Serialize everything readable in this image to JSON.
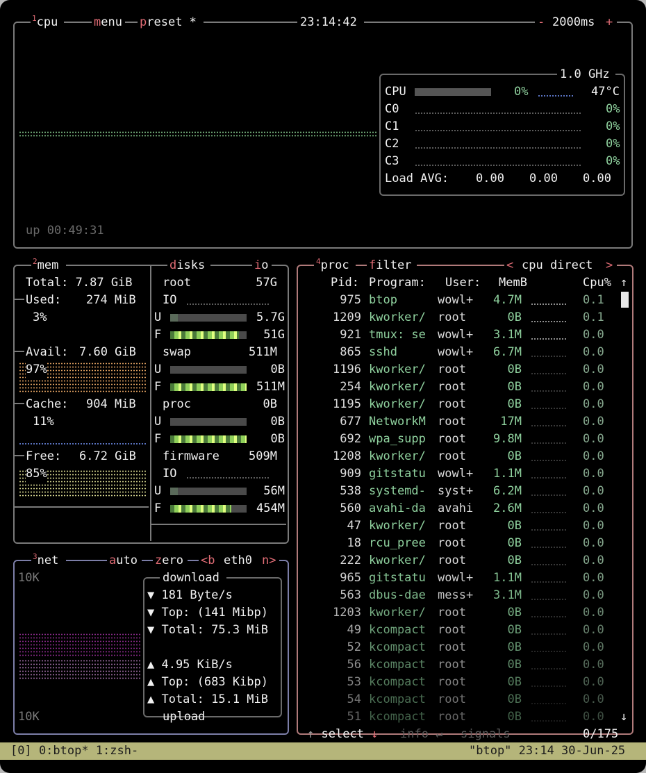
{
  "cpu": {
    "num": "1",
    "title": "cpu",
    "menu_m": "m",
    "menu": "enu",
    "preset_p": "p",
    "preset": "reset *",
    "clock": "23:14:42",
    "minus": "-",
    "interval": "2000ms",
    "plus": "+",
    "freq": "1.0 GHz",
    "total_label": "CPU",
    "total_pct": "0%",
    "temp": "47°C",
    "cores": [
      {
        "label": "C0",
        "pct": "0%"
      },
      {
        "label": "C1",
        "pct": "0%"
      },
      {
        "label": "C2",
        "pct": "0%"
      },
      {
        "label": "C3",
        "pct": "0%"
      }
    ],
    "load_label": "Load AVG:",
    "load": [
      "0.00",
      "0.00",
      "0.00"
    ],
    "uptime": "up 00:49:31"
  },
  "mem": {
    "num": "2",
    "title": "mem",
    "total": "Total: 7.87 GiB",
    "used_label": "Used:",
    "used_val": "274 MiB",
    "used_pct": "3%",
    "avail_label": "Avail:",
    "avail_val": "7.60 GiB",
    "avail_pct": "97%",
    "cache_label": "Cache:",
    "cache_val": "904 MiB",
    "cache_pct": "11%",
    "free_label": "Free:",
    "free_val": "6.72 GiB",
    "free_pct": "85%"
  },
  "disks": {
    "title_d": "d",
    "title": "isks",
    "io_i": "i",
    "io": "o",
    "items": [
      {
        "name": "root",
        "size": "57G",
        "rows": [
          {
            "k": "IO",
            "v": ""
          },
          {
            "k": "U",
            "v": "5.7G",
            "fill": 0.1
          },
          {
            "k": "F",
            "v": "51G",
            "fill": 0.9
          }
        ]
      },
      {
        "name": "swap",
        "size": "511M",
        "rows": [
          {
            "k": "U",
            "v": "0B",
            "fill": 0
          },
          {
            "k": "F",
            "v": "511M",
            "fill": 1
          }
        ]
      },
      {
        "name": "proc",
        "size": "0B",
        "rows": [
          {
            "k": "U",
            "v": "0B",
            "fill": 0
          },
          {
            "k": "F",
            "v": "0B",
            "fill": 1
          }
        ]
      },
      {
        "name": "firmware",
        "size": "509M",
        "rows": [
          {
            "k": "IO",
            "v": ""
          },
          {
            "k": "U",
            "v": "56M",
            "fill": 0.1
          },
          {
            "k": "F",
            "v": "454M",
            "fill": 0.8
          }
        ]
      }
    ]
  },
  "net": {
    "num": "3",
    "title": "net",
    "auto_a": "a",
    "auto": "uto",
    "zero_z": "z",
    "zero": "ero",
    "iface_b": "<b",
    "iface": "eth0",
    "iface_n": "n>",
    "scale_top": "10K",
    "scale_bottom": "10K",
    "download": "download",
    "upload": "upload",
    "down": [
      "▼ 181 Byte/s",
      "▼ Top: (141 Mibp)",
      "▼ Total: 75.3 MiB"
    ],
    "up": [
      "▲ 4.95 KiB/s",
      "▲ Top: (683 Kibp)",
      "▲ Total: 15.1 MiB"
    ]
  },
  "proc": {
    "num": "4",
    "title": "proc",
    "filter_f": "f",
    "filter": "ilter",
    "sort_l": "<",
    "sort": "cpu direct",
    "sort_r": ">",
    "headers": {
      "pid": "Pid:",
      "program": "Program:",
      "user": "User:",
      "mem": "MemB",
      "cpu": "Cpu%",
      "arrow": "↑"
    },
    "rows": [
      {
        "pid": "975",
        "prog": "btop",
        "user": "wowl+",
        "mem": "4.7M",
        "cpu": "0.1"
      },
      {
        "pid": "1209",
        "prog": "kworker/",
        "user": "root",
        "mem": "0B",
        "cpu": "0.1"
      },
      {
        "pid": "921",
        "prog": "tmux: se",
        "user": "wowl+",
        "mem": "3.1M",
        "cpu": "0.0"
      },
      {
        "pid": "865",
        "prog": "sshd",
        "user": "wowl+",
        "mem": "6.7M",
        "cpu": "0.0"
      },
      {
        "pid": "1196",
        "prog": "kworker/",
        "user": "root",
        "mem": "0B",
        "cpu": "0.0"
      },
      {
        "pid": "254",
        "prog": "kworker/",
        "user": "root",
        "mem": "0B",
        "cpu": "0.0"
      },
      {
        "pid": "1195",
        "prog": "kworker/",
        "user": "root",
        "mem": "0B",
        "cpu": "0.0"
      },
      {
        "pid": "677",
        "prog": "NetworkM",
        "user": "root",
        "mem": "17M",
        "cpu": "0.0"
      },
      {
        "pid": "692",
        "prog": "wpa_supp",
        "user": "root",
        "mem": "9.8M",
        "cpu": "0.0"
      },
      {
        "pid": "1208",
        "prog": "kworker/",
        "user": "root",
        "mem": "0B",
        "cpu": "0.0"
      },
      {
        "pid": "909",
        "prog": "gitstatu",
        "user": "wowl+",
        "mem": "1.1M",
        "cpu": "0.0"
      },
      {
        "pid": "538",
        "prog": "systemd-",
        "user": "syst+",
        "mem": "6.2M",
        "cpu": "0.0"
      },
      {
        "pid": "560",
        "prog": "avahi-da",
        "user": "avahi",
        "mem": "2.6M",
        "cpu": "0.0"
      },
      {
        "pid": "47",
        "prog": "kworker/",
        "user": "root",
        "mem": "0B",
        "cpu": "0.0"
      },
      {
        "pid": "18",
        "prog": "rcu_pree",
        "user": "root",
        "mem": "0B",
        "cpu": "0.0"
      },
      {
        "pid": "222",
        "prog": "kworker/",
        "user": "root",
        "mem": "0B",
        "cpu": "0.0"
      },
      {
        "pid": "965",
        "prog": "gitstatu",
        "user": "wowl+",
        "mem": "1.1M",
        "cpu": "0.0"
      },
      {
        "pid": "563",
        "prog": "dbus-dae",
        "user": "mess+",
        "mem": "3.1M",
        "cpu": "0.0"
      },
      {
        "pid": "1203",
        "prog": "kworker/",
        "user": "root",
        "mem": "0B",
        "cpu": "0.0"
      },
      {
        "pid": "49",
        "prog": "kcompact",
        "user": "root",
        "mem": "0B",
        "cpu": "0.0"
      },
      {
        "pid": "52",
        "prog": "kcompact",
        "user": "root",
        "mem": "0B",
        "cpu": "0.0"
      },
      {
        "pid": "56",
        "prog": "kcompact",
        "user": "root",
        "mem": "0B",
        "cpu": "0.0"
      },
      {
        "pid": "53",
        "prog": "kcompact",
        "user": "root",
        "mem": "0B",
        "cpu": "0.0"
      },
      {
        "pid": "54",
        "prog": "kcompact",
        "user": "root",
        "mem": "0B",
        "cpu": "0.0"
      },
      {
        "pid": "51",
        "prog": "kcompact",
        "user": "root",
        "mem": "0B",
        "cpu": "0.0"
      }
    ],
    "scroll_down": "↓",
    "select_up": "↑",
    "select": "select",
    "select_down": "↓",
    "info": "info",
    "enter": "↵",
    "signals": "signals",
    "count": "0/175"
  },
  "statusbar": {
    "left": "[0] 0:btop* 1:zsh-",
    "right": "\"btop\" 23:14 30-Jun-25"
  }
}
